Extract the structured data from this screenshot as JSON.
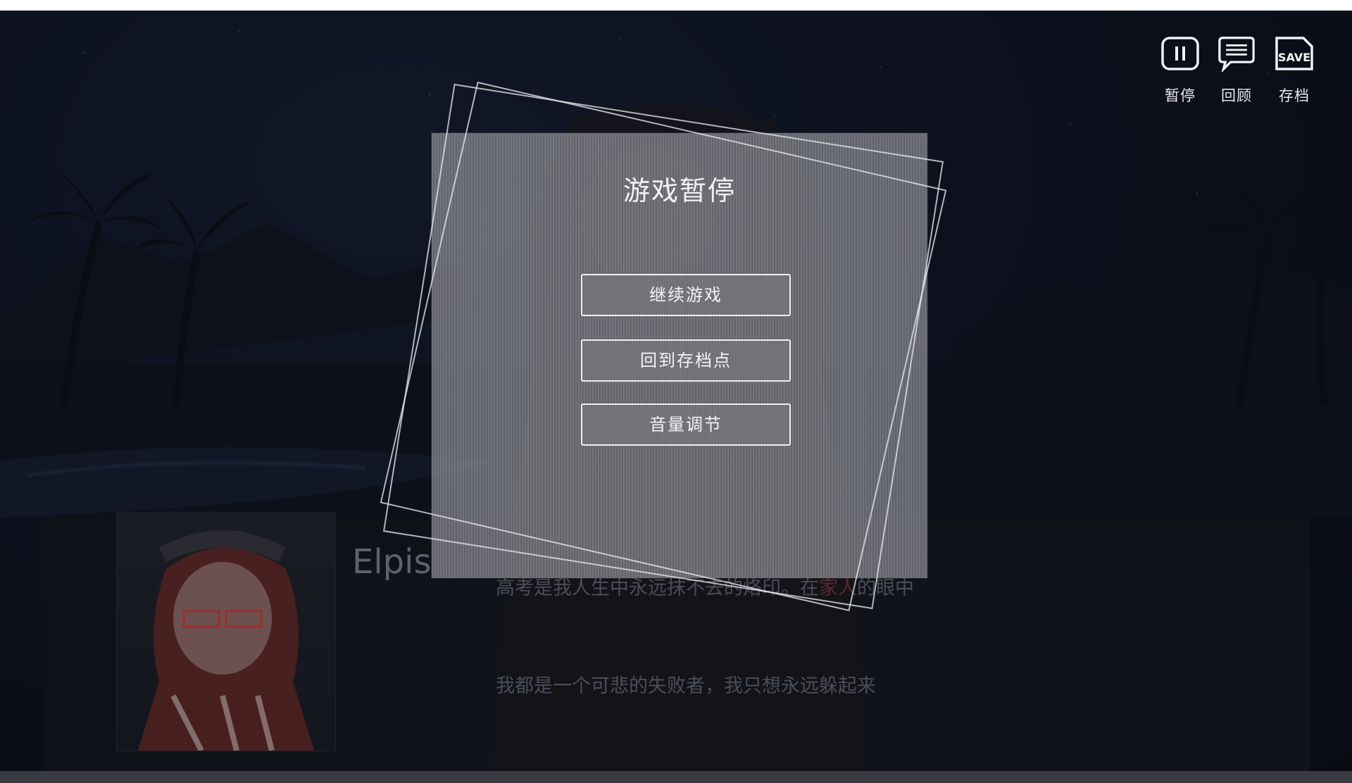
{
  "quick_menu": {
    "pause_label": "暂停",
    "review_label": "回顾",
    "save_label": "存档",
    "save_icon_text": "SAVE"
  },
  "dialogue": {
    "speaker": "Elpis",
    "line1_prefix": "高考是我人生中永远抹不去的烙印。在",
    "line1_highlight": "家人",
    "line1_suffix": "的眼中",
    "line2": "我都是一个可悲的失败者，我只想永远躲起来"
  },
  "pause_menu": {
    "title": "游戏暂停",
    "buttons": [
      "继续游戏",
      "回到存档点",
      "音量调节"
    ]
  },
  "colors": {
    "panel": "#a0a0a6",
    "button_border": "#f0f0f2",
    "text": "#f2f2f4"
  }
}
